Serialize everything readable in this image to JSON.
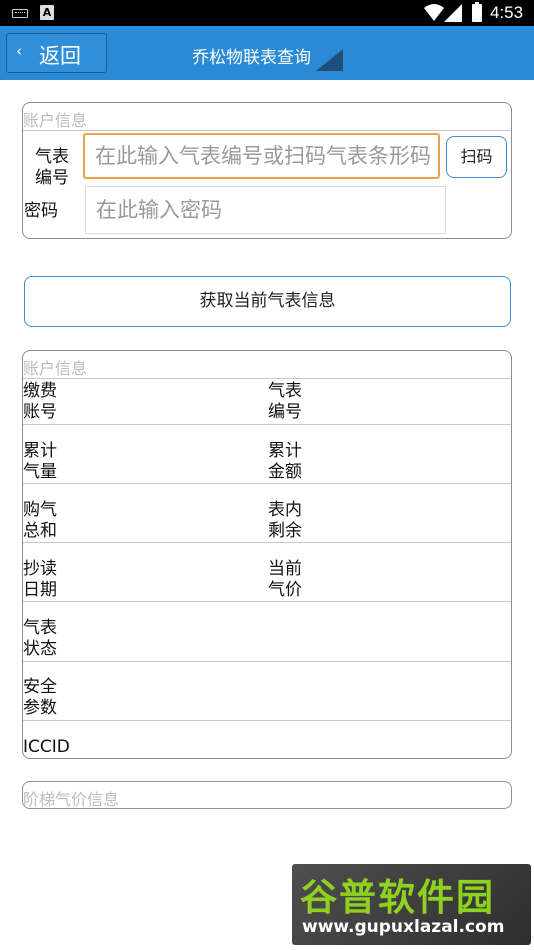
{
  "status_bar": {
    "time": "4:53"
  },
  "header": {
    "back_label": "返回",
    "title": "乔松物联表查询"
  },
  "query_form": {
    "section_title": "账户信息",
    "meter_label_line1": "气表",
    "meter_label_line2": "编号",
    "meter_placeholder": "在此输入气表编号或扫码气表条形码",
    "scan_label": "扫码",
    "password_label": "密码",
    "password_placeholder": "在此输入密码"
  },
  "fetch_button": "获取当前气表信息",
  "account_info": {
    "section_title": "账户信息",
    "rows": [
      {
        "left": [
          "缴费",
          "账号"
        ],
        "right": [
          "气表",
          "编号"
        ]
      },
      {
        "left": [
          "累计",
          "气量"
        ],
        "right": [
          "累计",
          "金额"
        ]
      },
      {
        "left": [
          "购气",
          "总和"
        ],
        "right": [
          "表内",
          "剩余"
        ]
      },
      {
        "left": [
          "抄读",
          "日期"
        ],
        "right": [
          "当前",
          "气价"
        ]
      },
      {
        "left": [
          "气表",
          "状态"
        ],
        "right": []
      },
      {
        "left": [
          "安全",
          "参数"
        ],
        "right": []
      },
      {
        "left": [
          "ICCID"
        ],
        "right": []
      }
    ]
  },
  "tier_price": {
    "section_title": "阶梯气价信息"
  },
  "watermark": {
    "name": "谷普软件园",
    "url": "www.gupuxlazal.com"
  }
}
